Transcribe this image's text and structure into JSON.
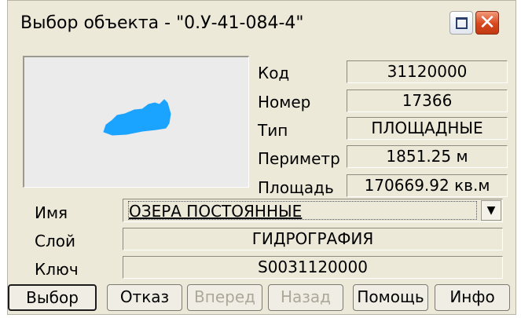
{
  "window": {
    "title": "Выбор объекта - \"0.У-41-084-4\""
  },
  "fields": {
    "code": {
      "label": "Код",
      "value": "31120000"
    },
    "number": {
      "label": "Номер",
      "value": "17366"
    },
    "type": {
      "label": "Тип",
      "value": "ПЛОЩАДНЫЕ"
    },
    "perimeter": {
      "label": "Периметр",
      "value": "1851.25  м"
    },
    "area": {
      "label": "Площадь",
      "value": "170669.92  кв.м"
    }
  },
  "name": {
    "label": "Имя",
    "value": "ОЗЕРА ПОСТОЯННЫЕ"
  },
  "layer": {
    "label": "Слой",
    "value": "ГИДРОГРАФИЯ"
  },
  "key": {
    "label": "Ключ",
    "value": "S0031120000"
  },
  "buttons": {
    "select": "Выбор",
    "cancel": "Отказ",
    "forward": "Вперед",
    "back": "Назад",
    "help": "Помощь",
    "info": "Инфо"
  },
  "colors": {
    "shape_fill": "#1aa3ff",
    "dialog_bg": "#ece9d8"
  }
}
